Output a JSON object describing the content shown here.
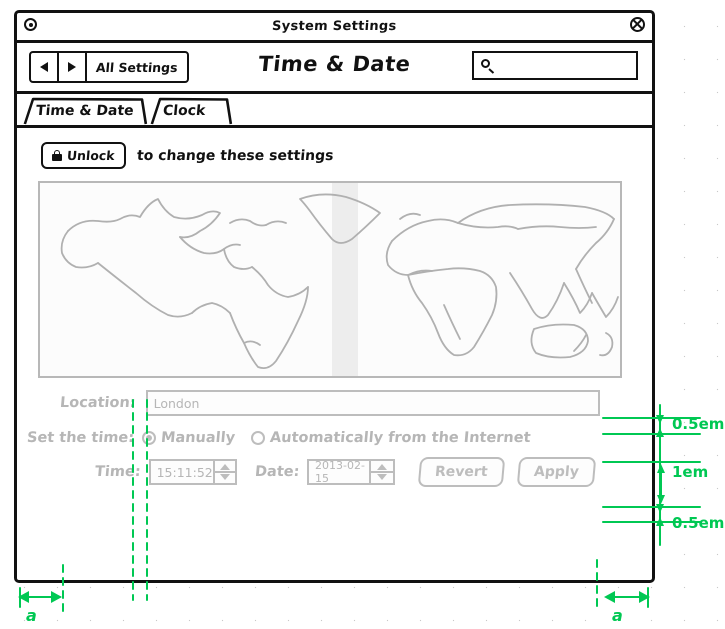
{
  "window": {
    "title": "System Settings",
    "icons": {
      "left": "record-circle-icon",
      "right": "close-icon"
    }
  },
  "toolbar": {
    "back_icon": "back-triangle-icon",
    "forward_icon": "forward-triangle-icon",
    "all_settings_label": "All Settings",
    "page_title": "Time & Date",
    "search": {
      "icon": "search-icon",
      "value": "",
      "placeholder": ""
    }
  },
  "tabs": [
    {
      "label": "Time & Date",
      "active": true
    },
    {
      "label": "Clock",
      "active": false
    }
  ],
  "lock": {
    "icon": "lock-icon",
    "button_label": "Unlock",
    "help_text": "to change these settings"
  },
  "map": {
    "name": "world-timezone-map",
    "highlight_band": "timezone-band"
  },
  "form": {
    "disabled": true,
    "location": {
      "label": "Location:",
      "value": "London",
      "placeholder": "London"
    },
    "set_time": {
      "label": "Set the time:",
      "options": [
        {
          "label": "Manually",
          "selected": true
        },
        {
          "label": "Automatically from the Internet",
          "selected": false
        }
      ]
    },
    "time": {
      "label": "Time:",
      "value": "15:11:52"
    },
    "date": {
      "label": "Date:",
      "value": "2013-02-15"
    },
    "buttons": [
      {
        "label": "Revert"
      },
      {
        "label": "Apply"
      }
    ]
  },
  "annotations": {
    "color": "#00c853",
    "measures": [
      {
        "id": "gap-above-location",
        "label": "0.5em"
      },
      {
        "id": "gap-location-to-settime",
        "label": "1em"
      },
      {
        "id": "gap-settime-to-values",
        "label": "0.5em"
      }
    ],
    "margins": [
      {
        "id": "left-margin",
        "label": "a"
      },
      {
        "id": "right-margin",
        "label": "a"
      }
    ]
  }
}
